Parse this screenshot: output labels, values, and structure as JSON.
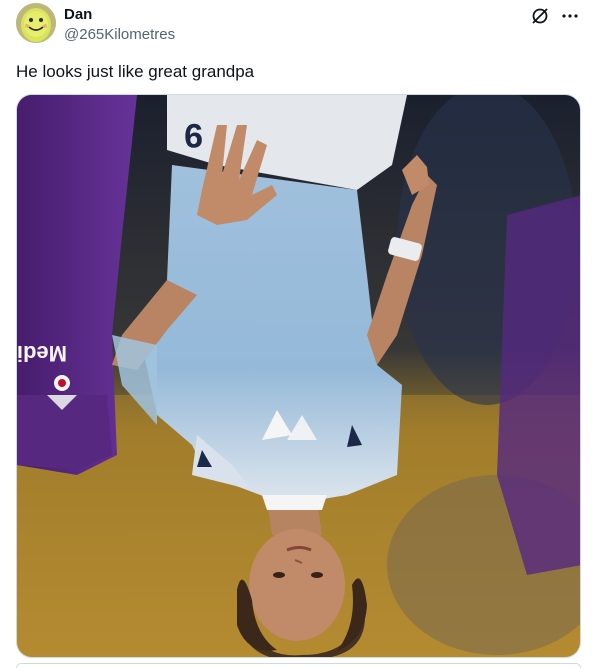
{
  "tweet": {
    "author": {
      "display_name": "Dan",
      "handle": "@265Kilometres",
      "avatar_icon": "smiley-face-avatar"
    },
    "text": "He looks just like great grandpa",
    "actions": {
      "grok_icon": "grok-icon",
      "more_icon": "more-icon"
    },
    "media": {
      "kit_number": "9",
      "sponsor_text": "Mediac"
    }
  },
  "colors": {
    "text_primary": "#0f1419",
    "text_secondary": "#536471",
    "border": "#cfd9de",
    "lazio_blue": "#a8cbe8",
    "fiorentina_purple": "#5b2a86"
  }
}
